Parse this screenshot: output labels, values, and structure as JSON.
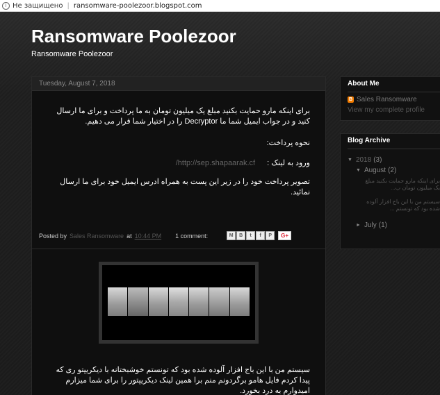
{
  "browser": {
    "security_label": "Не защищено",
    "url": "ransomware-poolezoor.blogspot.com"
  },
  "blog": {
    "title": "Ransomware Poolezoor",
    "description": "Ransomware Poolezoor"
  },
  "post1": {
    "date": "Tuesday, August 7, 2018",
    "para1": "برای اینکه مارو حمایت بکنید مبلغ یک میلیون تومان به ما پرداخت و برای ما ارسال کنید و در جواب ایمیل شما ما Decryptor را در اختیار شما قرار می دهیم.",
    "para2": "نحوه پرداخت:",
    "para3_label": "ورود به لینک :",
    "para3_link": "http://sep.shapaarak.cf/",
    "para4": "تصویر پرداخت خود را در زیر این پست به همراه ادرس ایمیل خود برای ما ارسال نمائید.",
    "footer": {
      "posted_by": "Posted by",
      "author": "Sales Ransomware",
      "at": "at",
      "time": "10:44 PM",
      "comments": "1 comment:",
      "share_icons": [
        "M",
        "B",
        "t",
        "f",
        "P"
      ],
      "gplus": "G+"
    }
  },
  "post2": {
    "para": "سیستم من با این باج افزار آلوده شده بود که تونستم خوشبختانه با دیکریپتو ری که پیدا کردم فایل هامو برگردونم منم برا همین لینک دیکریپتور را برای شما میزارم امیدوارم به درد بخورد."
  },
  "sidebar": {
    "about": {
      "heading": "About Me",
      "name": "Sales Ransomware",
      "profile_link": "View my complete profile"
    },
    "archive": {
      "heading": "Blog Archive",
      "year": "2018",
      "year_count": "(3)",
      "month1": "August",
      "month1_count": "(2)",
      "post_a": "برای اینکه مارو حمایت بکنید مبلغ یک میلیون تومان ب...",
      "post_b": "سیستم من با این باج افزار آلوده شده بود که تونستم ...",
      "month2": "July",
      "month2_count": "(1)"
    }
  }
}
